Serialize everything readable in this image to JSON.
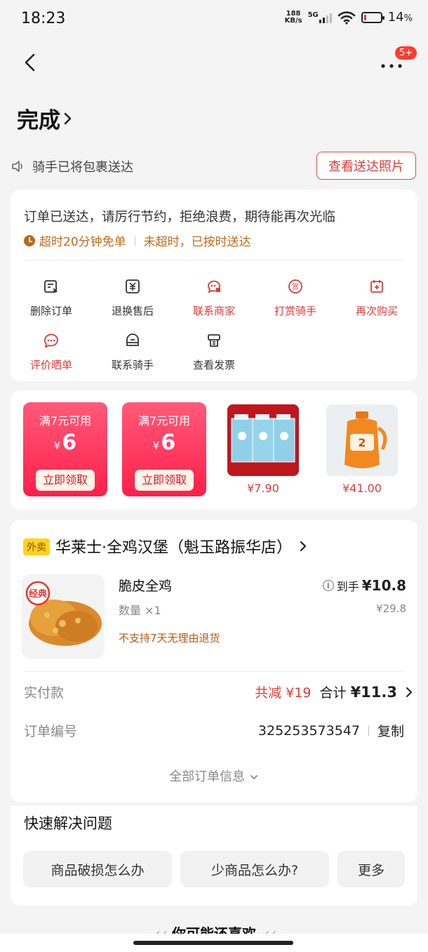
{
  "status_bar": {
    "time": "18:23",
    "net_speed_top": "188",
    "net_speed_bottom": "KB/s",
    "network": "5G",
    "battery": "14",
    "battery_unit": "%",
    "battery_level": 0.14
  },
  "nav": {
    "back_icon": "chevron-left-icon",
    "more_icon": "more-dots-icon",
    "badge": "5+"
  },
  "header": {
    "title": "完成"
  },
  "notice": {
    "text": "骑手已将包裹送达",
    "photo_button": "查看送达照片"
  },
  "order_status": {
    "message": "订单已送达，请厉行节约，拒绝浪费，期待能再次光临",
    "timeout_free": "超时20分钟免单",
    "on_time": "未超时，已按时送达"
  },
  "actions": [
    {
      "label": "删除订单",
      "icon": "delete-order-icon",
      "color": "#333333"
    },
    {
      "label": "退换售后",
      "icon": "refund-icon",
      "color": "#333333"
    },
    {
      "label": "联系商家",
      "icon": "chat-merchant-icon",
      "color": "#e53935"
    },
    {
      "label": "打赏骑手",
      "icon": "reward-icon",
      "color": "#e53935"
    },
    {
      "label": "再次购买",
      "icon": "rebuy-icon",
      "color": "#e53935"
    },
    {
      "label": "评价晒单",
      "icon": "review-icon",
      "color": "#e53935"
    },
    {
      "label": "联系骑手",
      "icon": "rider-icon",
      "color": "#333333"
    },
    {
      "label": "查看发票",
      "icon": "invoice-icon",
      "color": "#333333"
    }
  ],
  "promotions": {
    "coupons": [
      {
        "condition": "满7元可用",
        "currency": "¥",
        "amount": "6",
        "button": "立即领取"
      },
      {
        "condition": "满7元可用",
        "currency": "¥",
        "amount": "6",
        "button": "立即领取"
      }
    ],
    "products": [
      {
        "price": "¥7.90",
        "image": "milk-boxes"
      },
      {
        "price": "¥41.00",
        "image": "orange-drink-bottle"
      }
    ]
  },
  "order": {
    "tag": "外卖",
    "shop": "华莱士·全鸡汉堡（魁玉路振华店）",
    "item": {
      "image_badge": "经典",
      "name": "脆皮全鸡",
      "qty_label": "数量",
      "qty": "×1",
      "note": "不支持7天无理由退货",
      "to_hand_label": "到手",
      "to_hand_price": "¥10.8",
      "original_price": "¥29.8"
    },
    "paid_label": "实付款",
    "discount": "共减 ¥19",
    "total_label": "合计",
    "total": "¥11.3",
    "order_no_label": "订单编号",
    "order_no": "325253573547",
    "copy": "复制",
    "all_info": "全部订单信息"
  },
  "quick": {
    "title": "快速解决问题",
    "buttons": [
      "商品破损怎么办",
      "少商品怎么办?",
      "更多"
    ]
  },
  "recommend": {
    "title": "你可能还喜欢"
  }
}
